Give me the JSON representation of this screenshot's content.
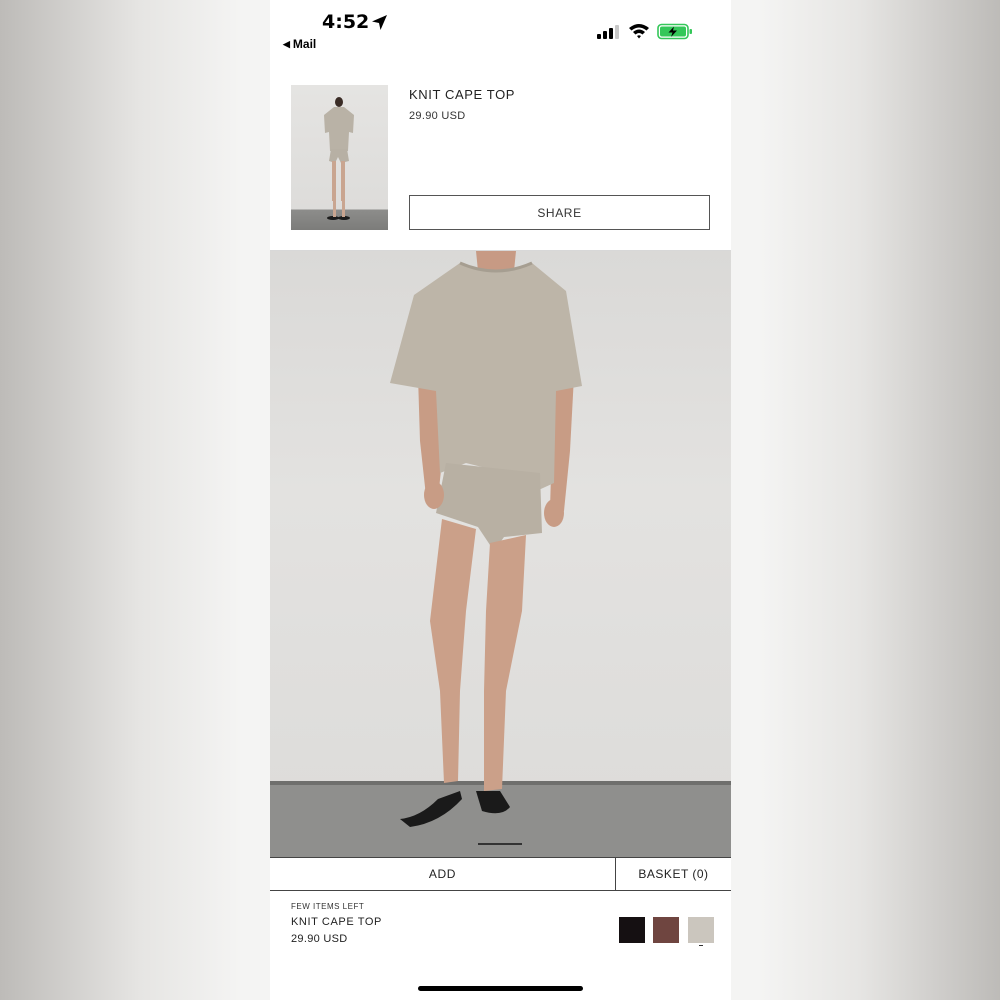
{
  "status_bar": {
    "time": "4:52",
    "back_label": "Mail",
    "icons": [
      "location-arrow-icon",
      "cellular-signal-icon",
      "wifi-icon",
      "battery-charging-icon"
    ],
    "battery_color": "#34c759"
  },
  "product_header": {
    "title": "KNIT CAPE TOP",
    "price": "29.90 USD",
    "share_label": "SHARE"
  },
  "main_image": {
    "description": "product-photo"
  },
  "actions": {
    "add_label": "ADD",
    "basket_label": "BASKET (0)"
  },
  "product_footer": {
    "stock_note": "FEW ITEMS LEFT",
    "title": "KNIT CAPE TOP",
    "price": "29.90 USD",
    "swatches": [
      {
        "name": "black",
        "color": "#151012"
      },
      {
        "name": "brown",
        "color": "#6f4540"
      },
      {
        "name": "stone",
        "color": "#cbc6be",
        "selected": true
      }
    ]
  }
}
